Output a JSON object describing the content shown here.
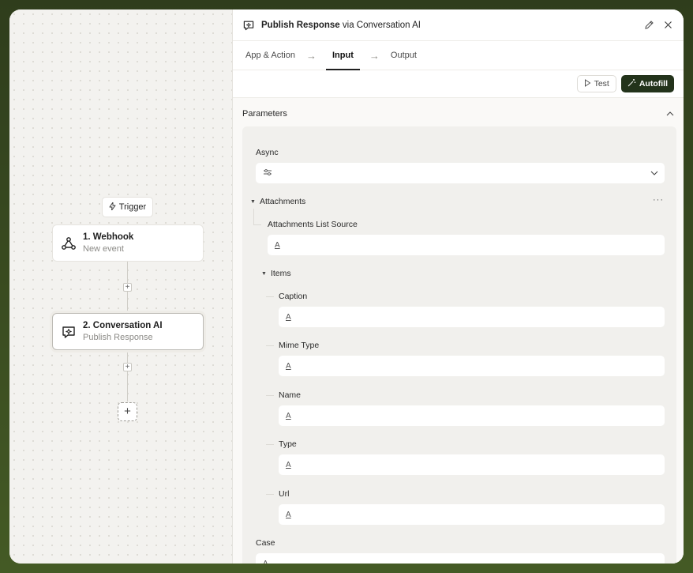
{
  "workflow": {
    "trigger_label": "Trigger",
    "nodes": [
      {
        "title": "1. Webhook",
        "subtitle": "New event"
      },
      {
        "title": "2. Conversation AI",
        "subtitle": "Publish Response"
      }
    ]
  },
  "panel": {
    "title_action": "Publish Response",
    "title_via": " via ",
    "title_app": "Conversation AI",
    "tabs": [
      "App & Action",
      "Input",
      "Output"
    ],
    "active_tab": "Input",
    "test_label": "Test",
    "autofill_label": "Autofill",
    "parameters_label": "Parameters",
    "fields": {
      "async_label": "Async",
      "attachments_label": "Attachments",
      "attachments_list_source_label": "Attachments List Source",
      "items_label": "Items",
      "caption_label": "Caption",
      "mime_type_label": "Mime Type",
      "name_label": "Name",
      "type_label": "Type",
      "url_label": "Url",
      "case_label": "Case",
      "text_glyph": "A",
      "more_glyph": "···"
    }
  },
  "colors": {
    "outer_bg": "#3c4f22",
    "autofill_bg": "#23331b"
  }
}
